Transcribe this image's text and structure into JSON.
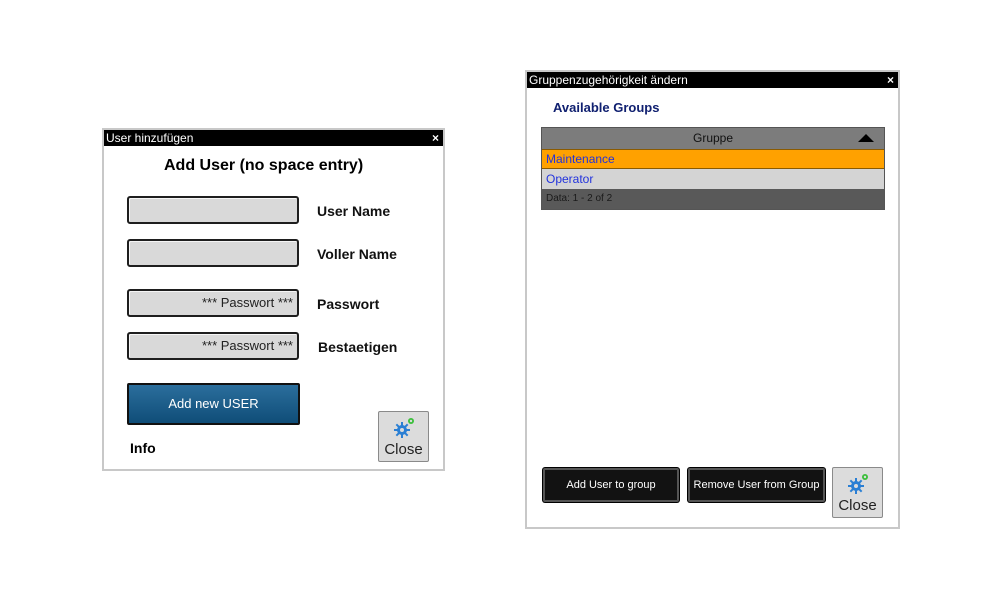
{
  "add_user_dialog": {
    "title": "User hinzufügen",
    "close_x": "×",
    "heading": "Add User (no space entry)",
    "fields": [
      {
        "value": "",
        "label": "User Name"
      },
      {
        "value": "",
        "label": "Voller Name"
      },
      {
        "value": "*** Passwort ***",
        "label": "Passwort"
      },
      {
        "value": "*** Passwort ***",
        "label": "Bestaetigen"
      }
    ],
    "add_button": "Add new USER",
    "info_label": "Info",
    "close_button": "Close"
  },
  "group_dialog": {
    "title": "Gruppenzugehörigkeit ändern",
    "close_x": "×",
    "heading": "Available Groups",
    "table": {
      "column_header": "Gruppe",
      "rows": [
        "Maintenance",
        "Operator"
      ],
      "selected_row": "Maintenance",
      "footer": "Data: 1 - 2 of 2"
    },
    "add_to_group_button": "Add User to group",
    "remove_from_group_button": "Remove User from Group",
    "close_button": "Close"
  },
  "colors": {
    "selected_row": "#ffa100",
    "primary_button": "#1a5a86",
    "heading_blue": "#102070"
  },
  "icons": {
    "close_button_icon": "gear-icon"
  }
}
